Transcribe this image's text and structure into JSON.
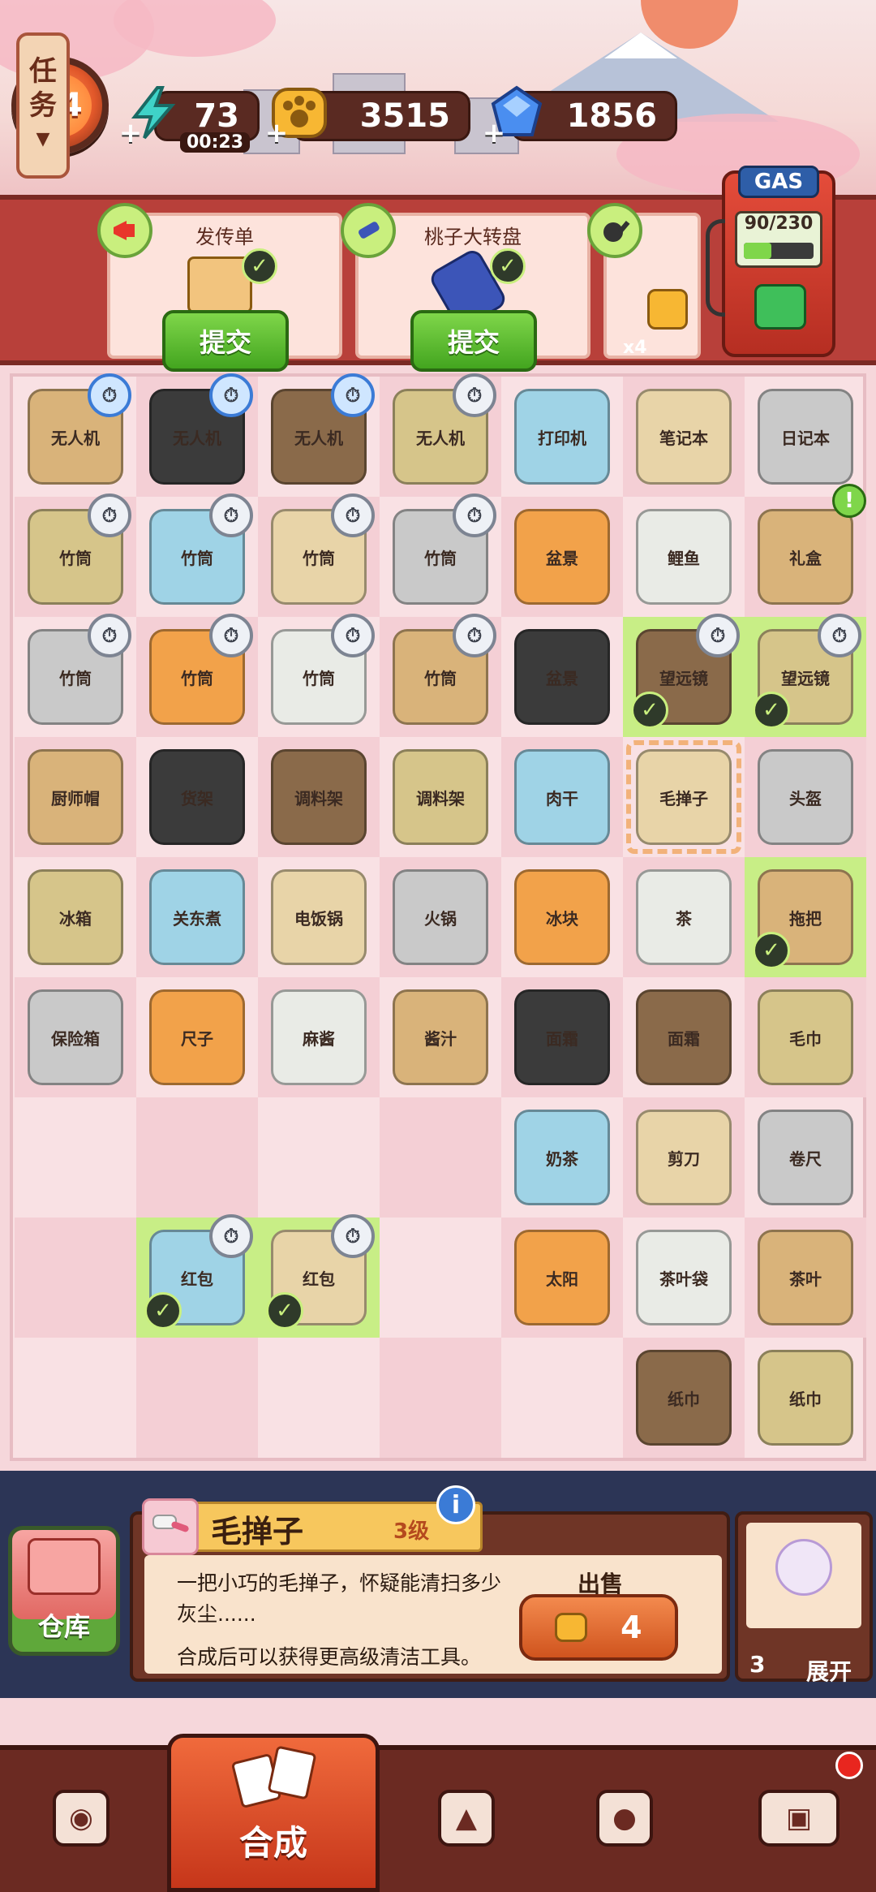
{
  "header": {
    "level": "34",
    "energy": {
      "value": "73",
      "timer": "00:23",
      "icon": "lightning-icon"
    },
    "coins": {
      "value": "3515",
      "icon": "paw-coin-icon"
    },
    "gems": {
      "value": "1856",
      "icon": "gem-icon"
    }
  },
  "tasks": {
    "tab_label": [
      "任",
      "务"
    ],
    "cards": [
      {
        "name": "发传单",
        "submit_label": "提交",
        "icon": "megaphone-icon"
      },
      {
        "name": "桃子大转盘",
        "submit_label": "提交",
        "icon": "telescope-icon"
      },
      {
        "name": "",
        "submit_label": "",
        "icon": "pan-icon",
        "count": "x4"
      }
    ]
  },
  "gas_pump": {
    "label": "GAS",
    "reading": "90/230",
    "fill_fraction": 0.39
  },
  "board": {
    "items": [
      [
        "无人机",
        "无人机",
        "无人机",
        "无人机",
        "打印机",
        "笔记本",
        "日记本"
      ],
      [
        "竹筒",
        "竹筒",
        "竹筒",
        "竹筒",
        "盆景",
        "鲤鱼",
        "礼盒"
      ],
      [
        "竹筒",
        "竹筒",
        "竹筒",
        "竹筒",
        "盆景",
        "望远镜",
        "望远镜"
      ],
      [
        "厨师帽",
        "货架",
        "调料架",
        "调料架",
        "肉干",
        "毛掸子",
        "头盔"
      ],
      [
        "冰箱",
        "关东煮",
        "电饭锅",
        "火锅",
        "冰块",
        "茶",
        "拖把"
      ],
      [
        "保险箱",
        "尺子",
        "麻酱",
        "酱汁",
        "面霜",
        "面霜",
        "毛巾"
      ],
      [
        "",
        "",
        "",
        "",
        "奶茶",
        "剪刀",
        "卷尺"
      ],
      [
        "",
        "红包",
        "红包",
        "",
        "太阳",
        "茶叶袋",
        "茶叶"
      ],
      [
        "",
        "",
        "",
        "",
        "",
        "纸巾",
        "纸巾"
      ]
    ]
  },
  "info_panel": {
    "storage_label": "仓库",
    "item_name": "毛掸子",
    "item_level": "3级",
    "description": "一把小巧的毛掸子，怀疑能清扫多少灰尘......",
    "hint": "合成后可以获得更高级清洁工具。",
    "sell_label": "出售",
    "sell_price": "4",
    "expand_count": "3",
    "expand_label": "展开"
  },
  "nav": {
    "merge_label": "合成",
    "items": [
      "shop-bag-icon",
      "service-bell-icon",
      "map-pin-icon",
      "bus-icon"
    ]
  },
  "colors": {
    "accent": "#e2582a",
    "ready_cell": "#c8ee86",
    "board_bg": "#f9e1e4",
    "nav_bg": "#6b2a22",
    "info_bg": "#2c3556"
  }
}
